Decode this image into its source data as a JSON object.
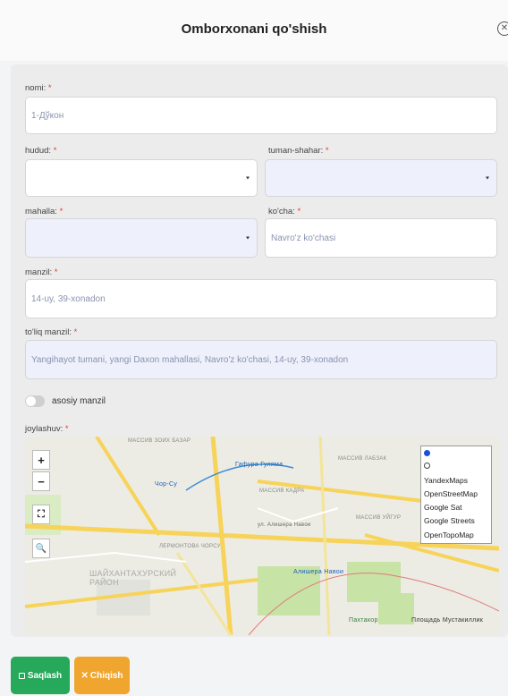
{
  "header": {
    "title": "Omborxonani qo'shish"
  },
  "form": {
    "nomi": {
      "label": "nomi:",
      "required": "*",
      "value": "1-Дўкон"
    },
    "hudud": {
      "label": "hudud:",
      "required": "*",
      "value": ""
    },
    "tuman": {
      "label": "tuman-shahar:",
      "required": "*",
      "value": ""
    },
    "mahalla": {
      "label": "mahalla:",
      "required": "*",
      "value": ""
    },
    "kocha": {
      "label": "ko'cha:",
      "required": "*",
      "value": "Navro'z ko'chasi"
    },
    "manzil": {
      "label": "manzil:",
      "required": "*",
      "value": "14-uy, 39-xonadon"
    },
    "toliq_manzil": {
      "label": "to'liq manzil:",
      "required": "*",
      "value": "Yangihayot tumani, yangi Daxon mahallasi, Navro'z ko'chasi, 14-uy, 39-xonadon"
    },
    "asosiy": {
      "label": "asosiy manzil",
      "checked": false
    },
    "joylashuv": {
      "label": "joylashuv:",
      "required": "*"
    }
  },
  "map": {
    "controls": {
      "zoom_in": "+",
      "zoom_out": "−",
      "fullscreen": "⛶",
      "search": "🔍"
    },
    "layers": [
      "YandexMaps",
      "OpenStreetMap",
      "Google Sat",
      "Google Streets",
      "OpenTopoMap"
    ],
    "selected_layer": 0,
    "labels": [
      "МАССИВ ЗОИХ БАЗАР",
      "Гафура Гуляма",
      "МАССИВ ЛАБЗАК",
      "Чор-Су",
      "МАССИВ КАДРА",
      "МАССИВ УЙГУР",
      "ул. Алишера Навои",
      "ЛЕРМОНТОВА ЧОРСУ",
      "ШАЙХАНТАХУРСКИЙ РАЙОН",
      "Алишера Навои",
      "Пахтакор",
      "Площадь Мустакиллик"
    ]
  },
  "actions": {
    "save": "Saqlash",
    "cancel": "Chiqish"
  },
  "colors": {
    "save": "#27a95c",
    "cancel": "#f0a52f",
    "required": "#e53935",
    "map_road": "#f7d35a",
    "map_park": "#c7e3a5"
  }
}
